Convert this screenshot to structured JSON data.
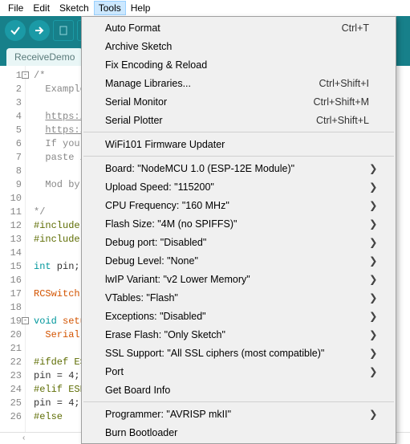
{
  "menubar": {
    "items": [
      "File",
      "Edit",
      "Sketch",
      "Tools",
      "Help"
    ],
    "active": 3
  },
  "tab": {
    "label": "ReceiveDemo"
  },
  "dropdown": {
    "groups": [
      [
        {
          "label": "Auto Format",
          "accel": "Ctrl+T"
        },
        {
          "label": "Archive Sketch"
        },
        {
          "label": "Fix Encoding & Reload"
        },
        {
          "label": "Manage Libraries...",
          "accel": "Ctrl+Shift+I"
        },
        {
          "label": "Serial Monitor",
          "accel": "Ctrl+Shift+M"
        },
        {
          "label": "Serial Plotter",
          "accel": "Ctrl+Shift+L"
        }
      ],
      [
        {
          "label": "WiFi101 Firmware Updater"
        }
      ],
      [
        {
          "label": "Board: \"NodeMCU 1.0 (ESP-12E Module)\"",
          "sub": true
        },
        {
          "label": "Upload Speed: \"115200\"",
          "sub": true
        },
        {
          "label": "CPU Frequency: \"160 MHz\"",
          "sub": true
        },
        {
          "label": "Flash Size: \"4M (no SPIFFS)\"",
          "sub": true
        },
        {
          "label": "Debug port: \"Disabled\"",
          "sub": true
        },
        {
          "label": "Debug Level: \"None\"",
          "sub": true
        },
        {
          "label": "lwIP Variant: \"v2 Lower Memory\"",
          "sub": true
        },
        {
          "label": "VTables: \"Flash\"",
          "sub": true
        },
        {
          "label": "Exceptions: \"Disabled\"",
          "sub": true
        },
        {
          "label": "Erase Flash: \"Only Sketch\"",
          "sub": true
        },
        {
          "label": "SSL Support: \"All SSL ciphers (most compatible)\"",
          "sub": true
        },
        {
          "label": "Port",
          "sub": true
        },
        {
          "label": "Get Board Info"
        }
      ],
      [
        {
          "label": "Programmer: \"AVRISP mkII\"",
          "sub": true
        },
        {
          "label": "Burn Bootloader"
        }
      ]
    ]
  },
  "code": {
    "lines": [
      {
        "n": 1,
        "fold": "-",
        "cls": "c-comment",
        "text": "/*"
      },
      {
        "n": 2,
        "cls": "c-comment",
        "text": "  Example"
      },
      {
        "n": 3,
        "cls": "c-comment",
        "text": ""
      },
      {
        "n": 4,
        "cls": "c-comment",
        "text": "  ",
        "link": "https:/"
      },
      {
        "n": 5,
        "cls": "c-comment",
        "text": "  ",
        "link": "https:/"
      },
      {
        "n": 6,
        "cls": "c-comment",
        "text": "  If you "
      },
      {
        "n": 7,
        "cls": "c-comment",
        "text": "  paste i"
      },
      {
        "n": 8,
        "cls": "c-comment",
        "text": ""
      },
      {
        "n": 9,
        "cls": "c-comment",
        "text": "  Mod by "
      },
      {
        "n": 10,
        "cls": "c-comment",
        "text": ""
      },
      {
        "n": 11,
        "cls": "c-comment",
        "text": "*/"
      },
      {
        "n": 12,
        "cls": "c-pre",
        "text": "#include "
      },
      {
        "n": 13,
        "cls": "c-pre",
        "text": "#include "
      },
      {
        "n": 14,
        "text": ""
      },
      {
        "n": 15,
        "html": "<span class='c-type'>int</span> pin;"
      },
      {
        "n": 16,
        "text": ""
      },
      {
        "n": 17,
        "html": "<span class='c-func'>RCSwitch</span>"
      },
      {
        "n": 18,
        "text": ""
      },
      {
        "n": 19,
        "fold": "-",
        "html": "<span class='c-type'>void</span> <span class='c-keyword'>setu</span>"
      },
      {
        "n": 20,
        "html": "  <span class='c-func'>Serial</span>."
      },
      {
        "n": 21,
        "text": ""
      },
      {
        "n": 22,
        "cls": "c-pre",
        "text": "#ifdef ES"
      },
      {
        "n": 23,
        "text": "pin = 4;"
      },
      {
        "n": 24,
        "cls": "c-pre",
        "text": "#elif ESP"
      },
      {
        "n": 25,
        "text": "pin = 4;"
      },
      {
        "n": 26,
        "cls": "c-pre",
        "text": "#else"
      }
    ]
  },
  "icons": {
    "verify": "verify-icon",
    "upload": "upload-icon",
    "new": "new-icon",
    "open": "open-icon",
    "save": "save-icon"
  }
}
